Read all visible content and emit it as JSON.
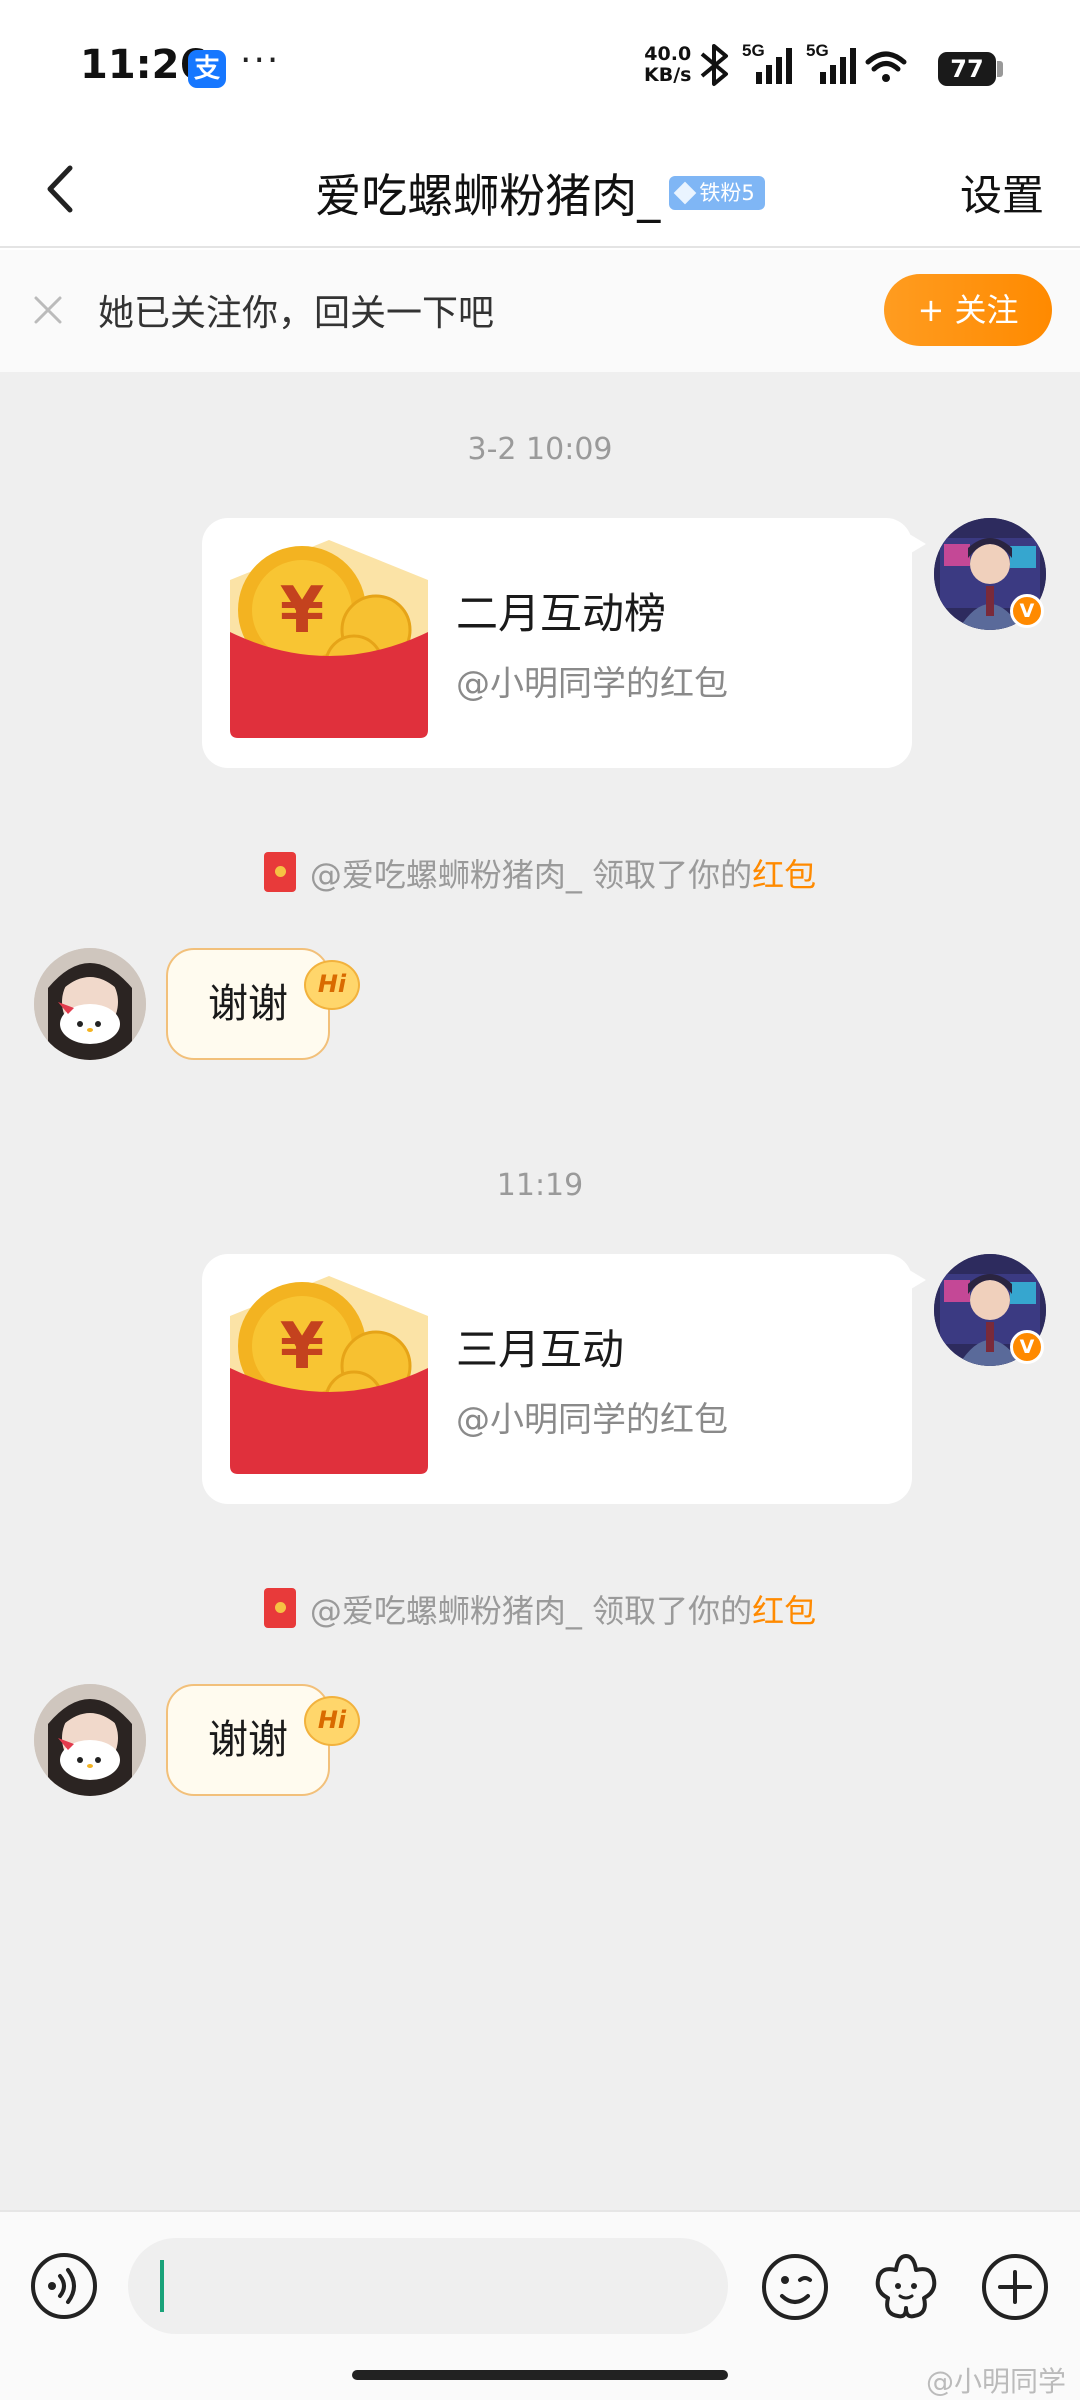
{
  "status_bar": {
    "time": "11:26",
    "alipay_icon": "支",
    "more_dots": "···",
    "net_speed_value": "40.0",
    "net_speed_unit": "KB/s",
    "network_1": "5G",
    "network_2": "5G",
    "battery": "77"
  },
  "header": {
    "title": "爱吃螺蛳粉猪肉_",
    "fan_badge": "铁粉5",
    "settings": "设置"
  },
  "follow_banner": {
    "text": "她已关注你，回关一下吧",
    "follow_button": "+ 关注"
  },
  "messages": [
    {
      "timestamp": "3-2 10:09",
      "red_packet": {
        "title": "二月互动榜",
        "subtitle": "@小明同学的红包"
      },
      "notice": {
        "text": "@爱吃螺蛳粉猪肉_ 领取了你的",
        "link": "红包"
      },
      "reply": {
        "text": "谢谢",
        "badge": "Hi"
      }
    },
    {
      "timestamp": "11:19",
      "red_packet": {
        "title": "三月互动",
        "subtitle": "@小明同学的红包"
      },
      "notice": {
        "text": "@爱吃螺蛳粉猪肉_ 领取了你的",
        "link": "红包"
      },
      "reply": {
        "text": "谢谢",
        "badge": "Hi"
      }
    }
  ],
  "verified_badge": "V",
  "watermark": "@小明同学",
  "colors": {
    "accent_orange": "#ff8a00",
    "chat_background": "#efefef",
    "red_packet_red": "#e0303c",
    "fan_badge_blue": "#7fb6f5"
  },
  "icons": {
    "back": "chevron-left-icon",
    "close": "close-icon",
    "voice": "voice-icon",
    "emoji": "emoji-icon",
    "sticker": "sticker-icon",
    "plus": "plus-icon"
  }
}
